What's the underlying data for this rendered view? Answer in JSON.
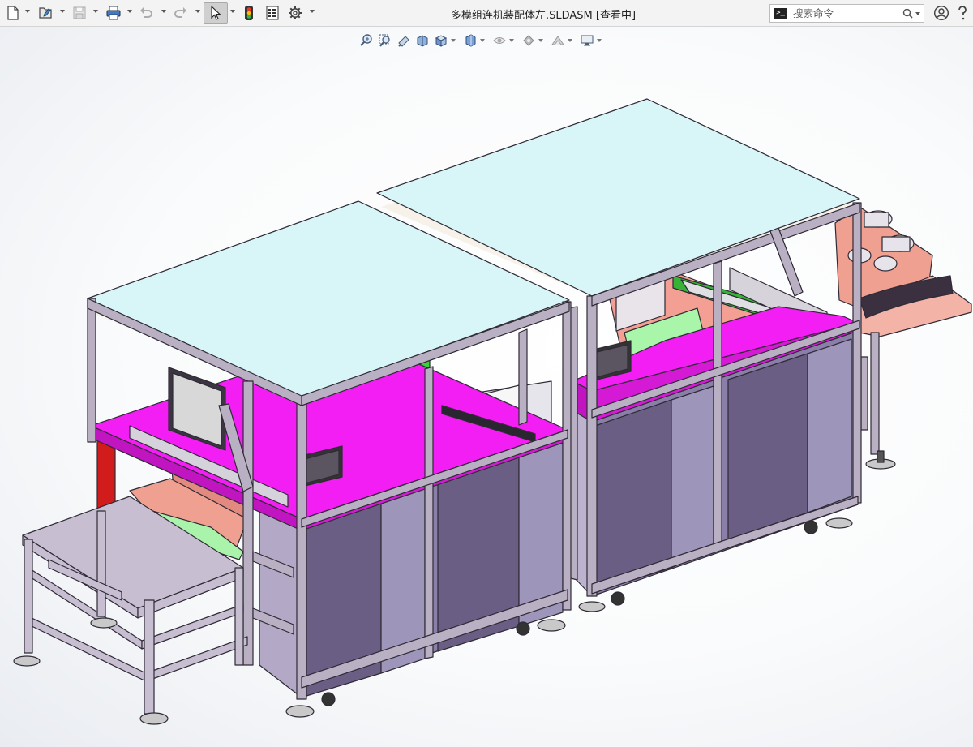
{
  "app": {
    "window_title": "多模组连机装配体左.SLDASM [查看中]"
  },
  "toolbar": {
    "buttons": [
      {
        "name": "new-document",
        "icon": "new-file-icon",
        "has_dropdown": true
      },
      {
        "name": "open-document",
        "icon": "open-file-icon",
        "has_dropdown": true
      },
      {
        "name": "save",
        "icon": "save-icon",
        "has_dropdown": true,
        "disabled": true
      },
      {
        "name": "print",
        "icon": "print-icon",
        "has_dropdown": true
      },
      {
        "name": "undo",
        "icon": "undo-icon",
        "has_dropdown": true,
        "disabled": true
      },
      {
        "name": "redo",
        "icon": "redo-icon",
        "has_dropdown": true,
        "disabled": true
      },
      {
        "name": "select",
        "icon": "cursor-icon",
        "has_dropdown": true,
        "active": true
      },
      {
        "name": "rebuild",
        "icon": "traffic-light-icon"
      },
      {
        "name": "file-properties",
        "icon": "properties-icon"
      },
      {
        "name": "options",
        "icon": "gear-icon",
        "has_dropdown": true
      }
    ]
  },
  "search": {
    "placeholder": "搜索命令",
    "prompt_glyph": ">_"
  },
  "user": {
    "icon": "user-account-icon",
    "help_icon": "help-icon"
  },
  "view_toolbar": {
    "items": [
      {
        "name": "zoom-to-fit",
        "icon": "zoom-fit-icon"
      },
      {
        "name": "zoom-to-area",
        "icon": "zoom-area-icon"
      },
      {
        "name": "previous-view",
        "icon": "previous-view-icon"
      },
      {
        "name": "section-view",
        "icon": "section-view-icon"
      },
      {
        "name": "view-orientation",
        "icon": "view-orientation-icon",
        "has_dropdown": true
      },
      {
        "name": "display-style",
        "icon": "display-style-icon",
        "has_dropdown": true
      },
      {
        "name": "hide-show-items",
        "icon": "hide-show-icon",
        "has_dropdown": true
      },
      {
        "name": "edit-appearance",
        "icon": "appearance-icon",
        "has_dropdown": true
      },
      {
        "name": "apply-scene",
        "icon": "scene-icon",
        "has_dropdown": true
      },
      {
        "name": "view-settings",
        "icon": "monitor-icon",
        "has_dropdown": true
      }
    ]
  },
  "colors": {
    "glass_top": "#d8f6f8",
    "frame": "#b9b0c4",
    "frame_edge": "#3a3340",
    "magenta_plate": "#f31ef3",
    "cabinet_panel": "#8a7fa8",
    "cabinet_panel_dark": "#6b5e84",
    "green_module": "#39d339",
    "salmon_plate": "#f0a090",
    "red_column": "#d21c1c",
    "monitor_screen": "#d8d8d8"
  }
}
